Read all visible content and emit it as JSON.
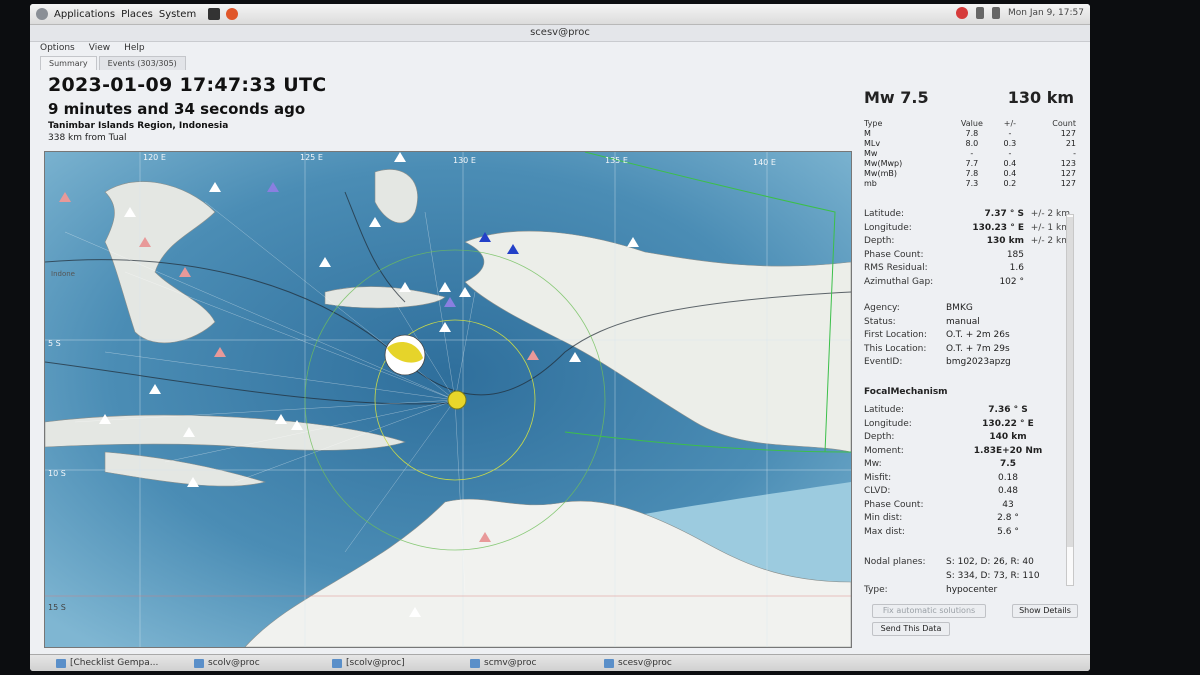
{
  "top_panel": {
    "menus": [
      "Applications",
      "Places",
      "System"
    ],
    "clock": "Mon Jan 9, 17:57"
  },
  "window": {
    "title": "scesv@proc",
    "menu": [
      "Options",
      "View",
      "Help"
    ],
    "tabs": [
      "Summary",
      "Events (303/305)"
    ]
  },
  "event": {
    "time": "2023-01-09 17:47:33 UTC",
    "ago": "9 minutes and 34 seconds ago",
    "region": "Tanimbar Islands Region, Indonesia",
    "distance": "338 km from Tual"
  },
  "map": {
    "lon_labels": [
      "120 E",
      "125 E",
      "130 E",
      "135 E",
      "140 E"
    ],
    "lat_labels": [
      "5 S",
      "10 S",
      "15 S"
    ],
    "place_labels": [
      "Indone"
    ]
  },
  "summary": {
    "magnitude": "Mw 7.5",
    "depth": "130 km",
    "mag_headers": [
      "Type",
      "Value",
      "+/-",
      "Count"
    ],
    "mag_rows": [
      [
        "M",
        "7.8",
        "-",
        "127"
      ],
      [
        "MLv",
        "8.0",
        "0.3",
        "21"
      ],
      [
        "Mw",
        "-",
        "-",
        "-"
      ],
      [
        "Mw(Mwp)",
        "7.7",
        "0.4",
        "123"
      ],
      [
        "Mw(mB)",
        "7.8",
        "0.4",
        "127"
      ],
      [
        "mb",
        "7.3",
        "0.2",
        "127"
      ]
    ],
    "origin": [
      {
        "k": "Latitude:",
        "v": "7.37 ° S",
        "u": "+/-  2 km",
        "bold": true
      },
      {
        "k": "Longitude:",
        "v": "130.23 ° E",
        "u": "+/-  1 km",
        "bold": true
      },
      {
        "k": "Depth:",
        "v": "130 km",
        "u": "+/-  2 km",
        "bold": true
      },
      {
        "k": "Phase Count:",
        "v": "185",
        "u": "",
        "bold": false
      },
      {
        "k": "RMS Residual:",
        "v": "1.6",
        "u": "",
        "bold": false
      },
      {
        "k": "Azimuthal Gap:",
        "v": "102 °",
        "u": "",
        "bold": false
      }
    ],
    "info": [
      {
        "k": "Agency:",
        "v": "BMKG"
      },
      {
        "k": "Status:",
        "v": "manual"
      },
      {
        "k": "First Location:",
        "v": "O.T. + 2m 26s"
      },
      {
        "k": "This Location:",
        "v": "O.T. + 7m 29s"
      },
      {
        "k": "EventID:",
        "v": "bmg2023apzg"
      }
    ],
    "fm_title": "FocalMechanism",
    "fm": [
      {
        "k": "Latitude:",
        "v": "7.36 ° S",
        "bold": true
      },
      {
        "k": "Longitude:",
        "v": "130.22 ° E",
        "bold": true
      },
      {
        "k": "Depth:",
        "v": "140 km",
        "bold": true
      },
      {
        "k": "Moment:",
        "v": "1.83E+20 Nm",
        "bold": true
      },
      {
        "k": "Mw:",
        "v": "7.5",
        "bold": true
      },
      {
        "k": "Misfit:",
        "v": "0.18",
        "bold": false
      },
      {
        "k": "CLVD:",
        "v": "0.48",
        "bold": false
      },
      {
        "k": "Phase Count:",
        "v": "43",
        "bold": false
      },
      {
        "k": "Min dist:",
        "v": "2.8 °",
        "bold": false
      },
      {
        "k": "Max dist:",
        "v": "5.6 °",
        "bold": false
      }
    ],
    "nodal_label": "Nodal planes:",
    "nodal_1": "S: 102, D: 26, R: 40",
    "nodal_2": "S: 334, D: 73, R: 110",
    "type_label": "Type:",
    "type_value": "hypocenter"
  },
  "buttons": {
    "fix": "Fix automatic solutions",
    "show": "Show Details",
    "send": "Send This Data"
  },
  "taskbar": [
    "[Checklist Gempa...",
    "scolv@proc",
    "[scolv@proc]",
    "scmv@proc",
    "scesv@proc"
  ],
  "colors": {
    "sea_deep": "#3e7ea8",
    "sea_shallow": "#8fc3da",
    "land": "#e9ece8",
    "epicenter": "#e8d62a"
  }
}
